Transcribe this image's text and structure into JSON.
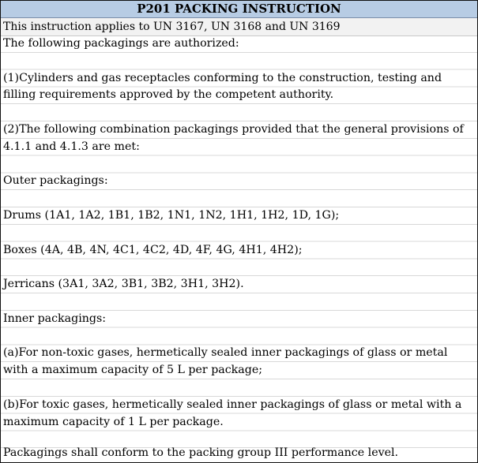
{
  "header": {
    "title": "P201 PACKING INSTRUCTION",
    "applies": "This instruction applies to UN 3167, UN 3168 and UN 3169"
  },
  "lines": [
    "The following packagings are authorized:",
    "(1)Cylinders and gas receptacles conforming to the construction, testing and filling requirements approved by the competent authority.",
    "(2)The following combination packagings provided that the general provisions of 4.1.1 and 4.1.3 are met:",
    "Outer packagings:",
    "Drums (1A1, 1A2, 1B1, 1B2, 1N1, 1N2, 1H1, 1H2, 1D, 1G);",
    "Boxes (4A, 4B, 4N, 4C1, 4C2, 4D, 4F, 4G, 4H1, 4H2);",
    "Jerricans (3A1, 3A2, 3B1, 3B2, 3H1, 3H2).",
    "Inner packagings:",
    "(a)For non-toxic gases, hermetically sealed inner packagings of glass or metal with a maximum capacity of 5 L per package;",
    "(b)For toxic gases, hermetically sealed inner packagings of glass or metal with a maximum capacity of 1 L per package.",
    "Packagings shall conform to the packing group III performance level."
  ]
}
